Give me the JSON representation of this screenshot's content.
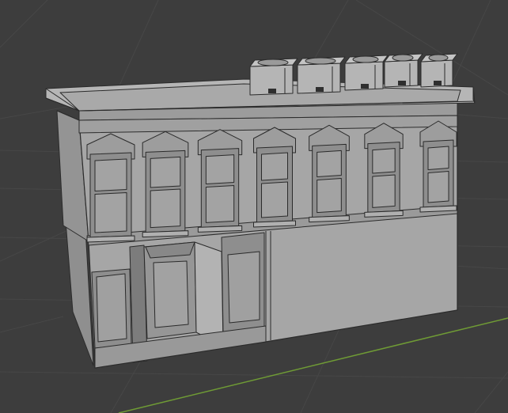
{
  "viewport": {
    "background_color": "#3d3d3d",
    "grid_line_color": "#474747",
    "x_axis_color": "#6f9b35"
  },
  "scene": {
    "object": "building-model",
    "mode": "solid",
    "wireframe_overlay": true,
    "upper_floor_window_count": 7,
    "rooftop_unit_count": 5,
    "ground_floor": {
      "left_windows": 1,
      "doorway": 1,
      "right_windows": 1
    },
    "colors": {
      "front_face": "#a6a6a6",
      "side_face": "#8f8f8f",
      "roof_top": "#b6b6b6",
      "edge_lines": "#2b2b2b"
    }
  }
}
